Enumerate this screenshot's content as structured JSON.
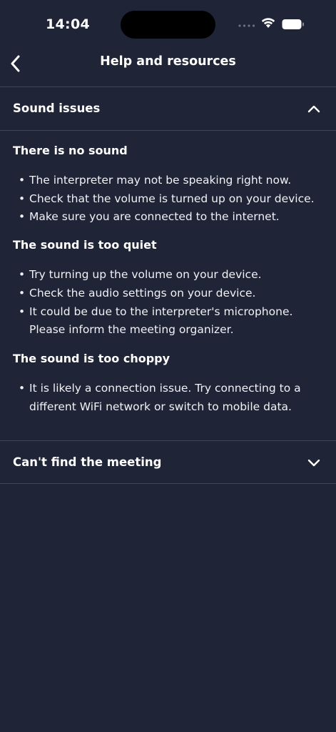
{
  "status_bar": {
    "time": "14:04"
  },
  "nav": {
    "title": "Help and resources",
    "back_icon": "chevron-left-icon"
  },
  "sections": [
    {
      "title": "Sound issues",
      "expanded": true,
      "icon": "chevron-up-icon",
      "groups": [
        {
          "heading": "There is no sound",
          "items": [
            [
              "The interpreter may not be speaking right now."
            ],
            [
              "Check that the volume is turned up on your device."
            ],
            [
              "Make sure you are connected to the internet."
            ]
          ]
        },
        {
          "heading": "The sound is too quiet",
          "items": [
            [
              "Try turning up the volume on your device."
            ],
            [
              "Check the audio settings on your device."
            ],
            [
              "It could be due to the interpreter's microphone.",
              "Please inform the meeting organizer."
            ]
          ]
        },
        {
          "heading": "The sound is too choppy",
          "items": [
            [
              "It is likely a connection issue. Try connecting to a",
              "different WiFi network or switch to mobile data."
            ]
          ]
        }
      ]
    },
    {
      "title": "Can't find the meeting",
      "expanded": false,
      "icon": "chevron-down-icon"
    }
  ],
  "colors": {
    "background": "#1f2436",
    "divider": "#3f4557",
    "text": "#ffffff"
  }
}
